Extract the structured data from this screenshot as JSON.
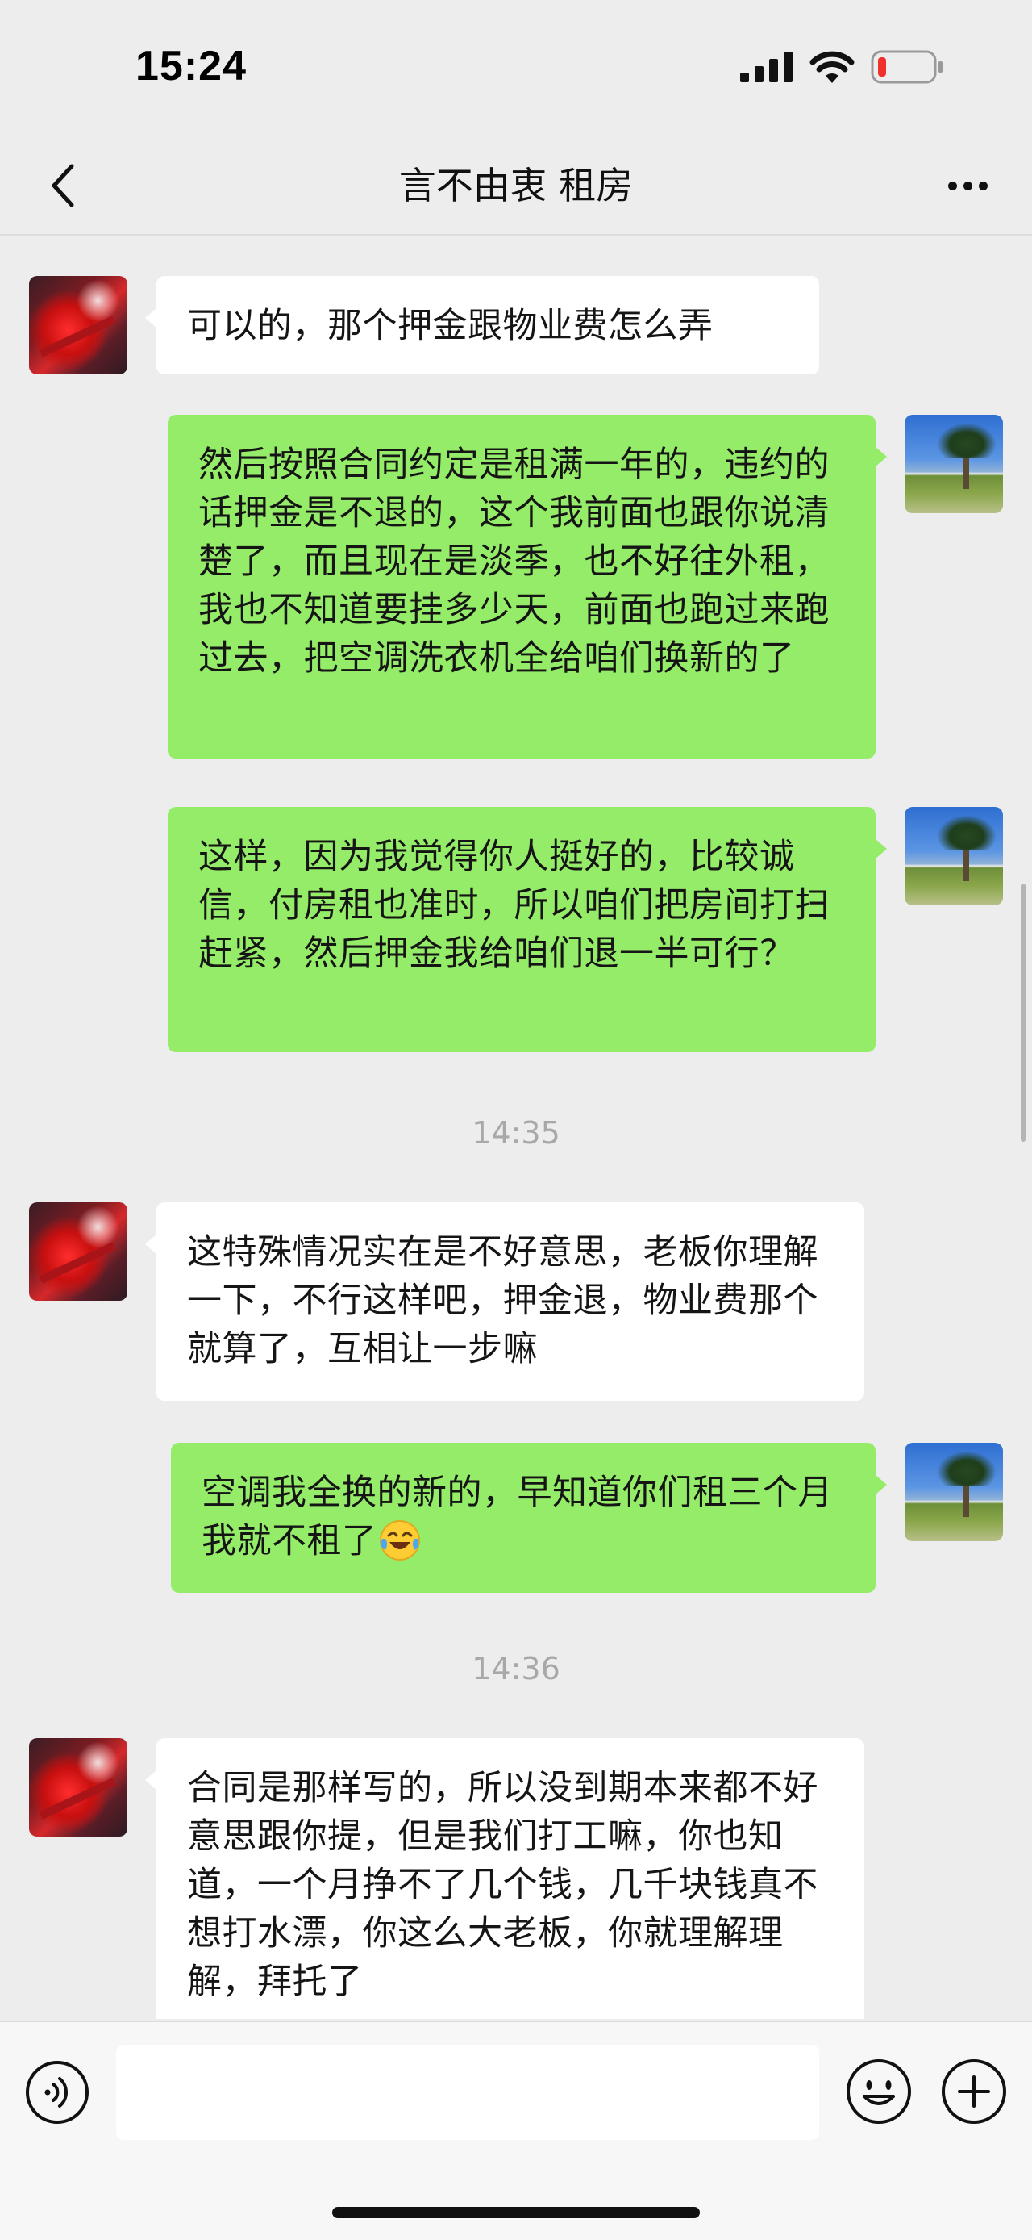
{
  "status_bar": {
    "time": "15:24",
    "icons": [
      "signal-icon",
      "wifi-icon",
      "battery-low-icon"
    ]
  },
  "nav": {
    "title": "言不由衷 租房",
    "back_icon": "chevron-left-icon",
    "more_icon": "more-dots-icon"
  },
  "messages": [
    {
      "side": "left",
      "avatar": "tenant",
      "text": "可以的，那个押金跟物业费怎么弄"
    },
    {
      "side": "right",
      "avatar": "landlord",
      "text": "然后按照合同约定是租满一年的，违约的话押金是不退的，这个我前面也跟你说清楚了，而且现在是淡季，也不好往外租，我也不知道要挂多少天，前面也跑过来跑过去，把空调洗衣机全给咱们换新的了"
    },
    {
      "side": "right",
      "avatar": "landlord",
      "text": "这样，因为我觉得你人挺好的，比较诚信，付房租也准时，所以咱们把房间打扫赶紧，然后押金我给咱们退一半可行？"
    },
    {
      "type": "time",
      "text": "14:35"
    },
    {
      "side": "left",
      "avatar": "tenant",
      "text": "这特殊情况实在是不好意思，老板你理解一下，不行这样吧，押金退，物业费那个就算了，互相让一步嘛"
    },
    {
      "side": "right",
      "avatar": "landlord",
      "text": "空调我全换的新的，早知道你们租三个月我就不租了",
      "emoji": "crying-laughing-emoji"
    },
    {
      "type": "time",
      "text": "14:36"
    },
    {
      "side": "left",
      "avatar": "tenant",
      "text": "合同是那样写的，所以没到期本来都不好意思跟你提，但是我们打工嘛，你也知道，一个月挣不了几个钱，几千块钱真不想打水漂，你这么大老板，你就理解理解，拜托了"
    }
  ],
  "input_bar": {
    "voice_icon": "voice-icon",
    "input_value": "",
    "emoji_icon": "emoji-icon",
    "plus_icon": "plus-icon"
  },
  "colors": {
    "background": "#ededed",
    "sent_bubble": "#95ec69",
    "received_bubble": "#ffffff",
    "timestamp": "#a8a8a8"
  }
}
